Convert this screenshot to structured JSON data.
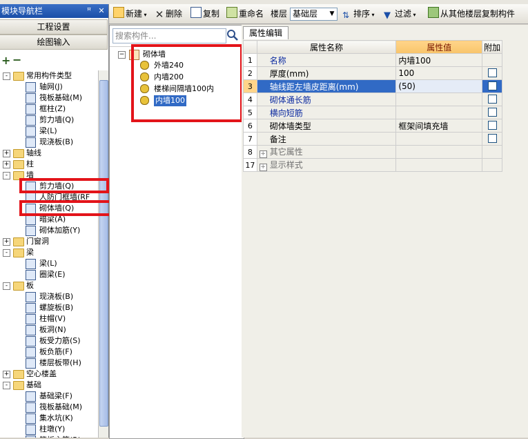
{
  "app": {
    "panel_title": "模块导航栏",
    "pin_glyph": "ꟸ",
    "close_glyph": "✕"
  },
  "left_nav": {
    "btn_settings": "工程设置",
    "btn_drawing": "绘图输入",
    "tool_add": "+",
    "tool_collapse": "−",
    "tree": [
      {
        "label": "常用构件类型",
        "level": 0,
        "expand": "-",
        "kind": "folder"
      },
      {
        "label": "轴网(J)",
        "level": 1,
        "kind": "grid-icon"
      },
      {
        "label": "筏板基础(M)",
        "level": 1,
        "kind": "raft-icon"
      },
      {
        "label": "框柱(Z)",
        "level": 1,
        "kind": "column-icon"
      },
      {
        "label": "剪力墙(Q)",
        "level": 1,
        "kind": "shearwall-icon"
      },
      {
        "label": "梁(L)",
        "level": 1,
        "kind": "beam-icon"
      },
      {
        "label": "现浇板(B)",
        "level": 1,
        "kind": "slab-icon"
      },
      {
        "label": "轴线",
        "level": 0,
        "expand": "+",
        "kind": "folder"
      },
      {
        "label": "柱",
        "level": 0,
        "expand": "+",
        "kind": "folder"
      },
      {
        "label": "墙",
        "level": 0,
        "expand": "-",
        "kind": "folder"
      },
      {
        "label": "剪力墙(Q)",
        "level": 1,
        "kind": "shearwall-icon"
      },
      {
        "label": "人防门框墙(RF",
        "level": 1,
        "kind": "door-frame-wall-icon"
      },
      {
        "label": "砌体墙(Q)",
        "level": 1,
        "kind": "masonry-wall-icon"
      },
      {
        "label": "暗梁(A)",
        "level": 1,
        "kind": "hidden-beam-icon"
      },
      {
        "label": "砌体加筋(Y)",
        "level": 1,
        "kind": "masonry-rebar-icon"
      },
      {
        "label": "门窗洞",
        "level": 0,
        "expand": "+",
        "kind": "folder"
      },
      {
        "label": "梁",
        "level": 0,
        "expand": "-",
        "kind": "folder"
      },
      {
        "label": "梁(L)",
        "level": 1,
        "kind": "beam-icon"
      },
      {
        "label": "圈梁(E)",
        "level": 1,
        "kind": "ring-beam-icon"
      },
      {
        "label": "板",
        "level": 0,
        "expand": "-",
        "kind": "folder"
      },
      {
        "label": "现浇板(B)",
        "level": 1,
        "kind": "slab-icon"
      },
      {
        "label": "螺旋板(B)",
        "level": 1,
        "kind": "spiral-slab-icon"
      },
      {
        "label": "柱帽(V)",
        "level": 1,
        "kind": "column-cap-icon"
      },
      {
        "label": "板洞(N)",
        "level": 1,
        "kind": "slab-hole-icon"
      },
      {
        "label": "板受力筋(S)",
        "level": 1,
        "kind": "slab-rebar-icon"
      },
      {
        "label": "板负筋(F)",
        "level": 1,
        "kind": "slab-neg-rebar-icon"
      },
      {
        "label": "楼层板带(H)",
        "level": 1,
        "kind": "slab-strip-icon"
      },
      {
        "label": "空心楼盖",
        "level": 0,
        "expand": "+",
        "kind": "folder"
      },
      {
        "label": "基础",
        "level": 0,
        "expand": "-",
        "kind": "folder"
      },
      {
        "label": "基础梁(F)",
        "level": 1,
        "kind": "foundation-beam-icon"
      },
      {
        "label": "筏板基础(M)",
        "level": 1,
        "kind": "raft-icon"
      },
      {
        "label": "集水坑(K)",
        "level": 1,
        "kind": "sump-icon"
      },
      {
        "label": "柱墩(Y)",
        "level": 1,
        "kind": "column-pier-icon"
      },
      {
        "label": "筏板主筋(R)",
        "level": 1,
        "kind": "raft-rebar-icon"
      }
    ]
  },
  "toolbar": {
    "new": "新建",
    "delete": "删除",
    "copy": "复制",
    "rename": "重命名",
    "floor_label": "楼层",
    "floor_value": "基础层",
    "sort": "排序",
    "filter": "过滤",
    "copy_from_floor": "从其他楼层复制构件"
  },
  "components": {
    "search_placeholder": "搜索构件...",
    "root": "砌体墙",
    "items": [
      "外墙240",
      "内墙200",
      "楼梯间隔墙100内",
      "内墙100"
    ],
    "selected_index": 3
  },
  "properties": {
    "tab": "属性编辑",
    "headers": {
      "name": "属性名称",
      "value": "属性值",
      "extra": "附加"
    },
    "rows": [
      {
        "num": "1",
        "name": "名称",
        "value": "内墙100",
        "color": "blue",
        "checkbox": false
      },
      {
        "num": "2",
        "name": "厚度(mm)",
        "value": "100",
        "color": "black",
        "checkbox": true
      },
      {
        "num": "3",
        "name": "轴线距左墙皮距离(mm)",
        "value": "(50)",
        "color": "black",
        "checkbox": true,
        "selected": true
      },
      {
        "num": "4",
        "name": "砌体通长筋",
        "value": "",
        "color": "blue",
        "checkbox": true
      },
      {
        "num": "5",
        "name": "横向短筋",
        "value": "",
        "color": "blue",
        "checkbox": true
      },
      {
        "num": "6",
        "name": "砌体墙类型",
        "value": "框架间填充墙",
        "color": "black",
        "checkbox": true
      },
      {
        "num": "7",
        "name": "备注",
        "value": "",
        "color": "black",
        "checkbox": true
      },
      {
        "num": "8",
        "name": "其它属性",
        "value": "",
        "color": "gray",
        "checkbox": false,
        "group": true
      },
      {
        "num": "17",
        "name": "显示样式",
        "value": "",
        "color": "gray",
        "checkbox": false,
        "group": true
      }
    ]
  },
  "colors": {
    "highlight_box": "#e3141a",
    "selection": "#316ac5",
    "value_header": "#f8c46a",
    "title_bar": "#1b4fa8"
  }
}
